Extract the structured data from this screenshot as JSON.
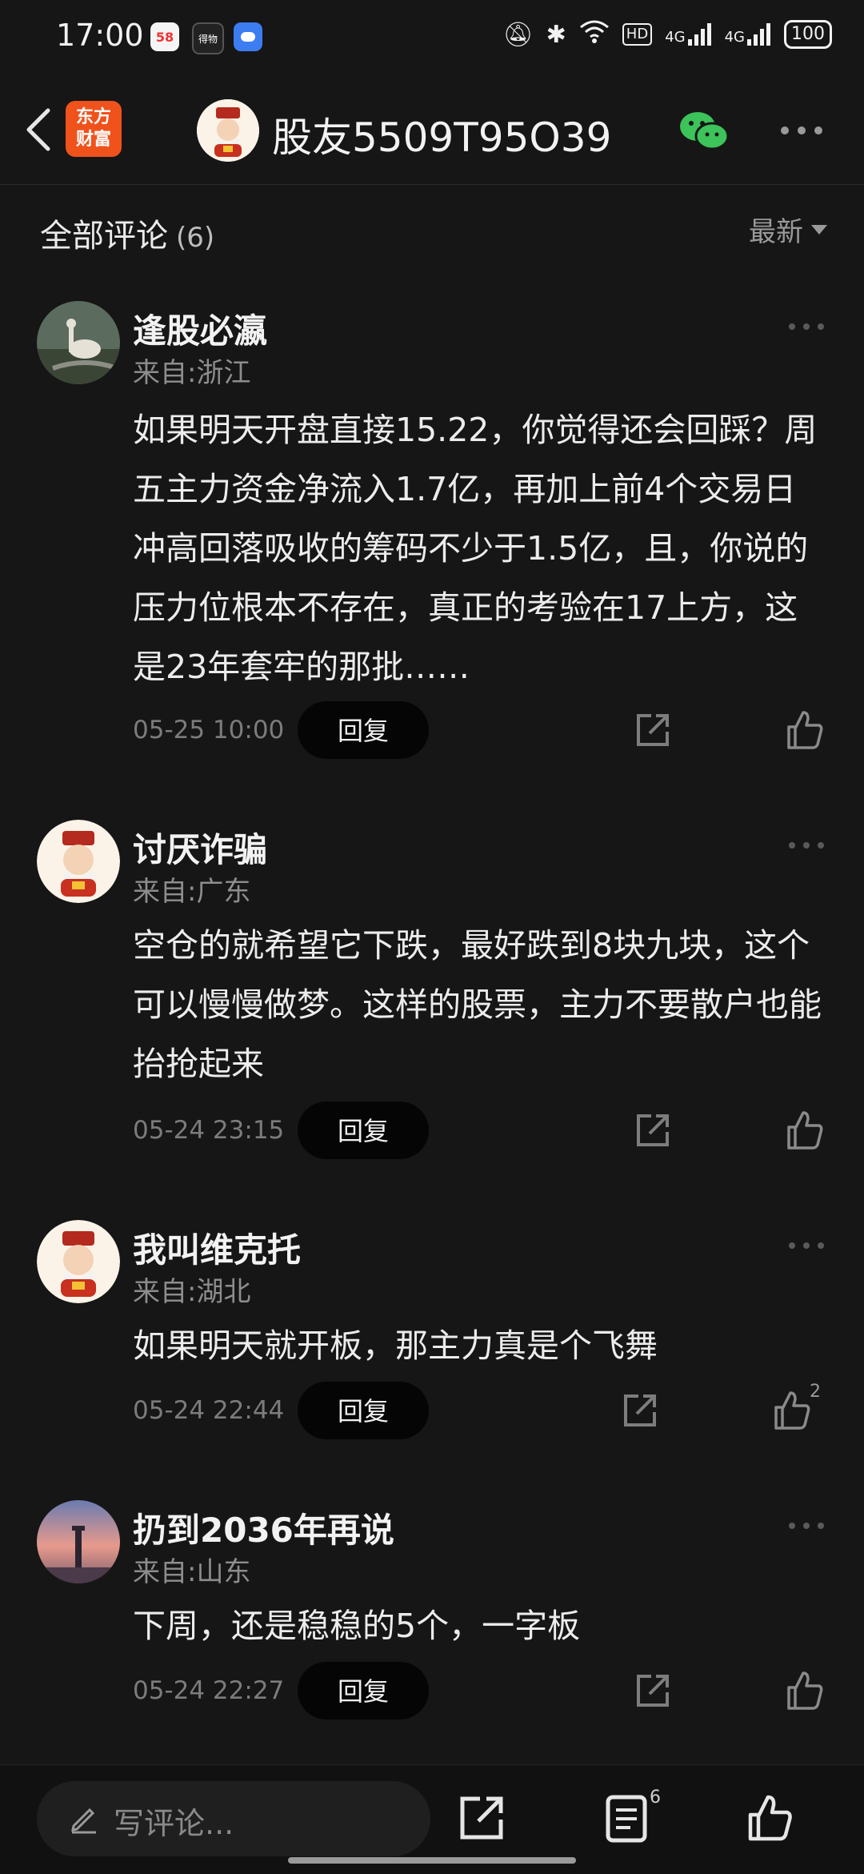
{
  "status_bar": {
    "time": "17:00",
    "apps": [
      "58",
      "得物",
      "meet"
    ],
    "network_1": "4G",
    "network_2": "4G",
    "hd": "HD",
    "battery": "100"
  },
  "header": {
    "logo_text_1": "东方",
    "logo_text_2": "财富",
    "title": "股友5509T95O39"
  },
  "section": {
    "title": "全部评论",
    "count": "(6)",
    "sort_label": "最新"
  },
  "comments": [
    {
      "user": "逢股必瀛",
      "location": "来自:浙江",
      "text": "如果明天开盘直接15.22，你觉得还会回踩？周五主力资金净流入1.7亿，再加上前4个交易日冲高回落吸收的筹码不少于1.5亿，且，你说的压力位根本不存在，真正的考验在17上方，这是23年套牢的那批……",
      "time": "05-25 10:00",
      "reply_label": "回复",
      "likes": ""
    },
    {
      "user": "讨厌诈骗",
      "location": "来自:广东",
      "text": "空仓的就希望它下跌，最好跌到8块九块，这个可以慢慢做梦。这样的股票，主力不要散户也能抬抢起来",
      "time": "05-24 23:15",
      "reply_label": "回复",
      "likes": ""
    },
    {
      "user": "我叫维克托",
      "location": "来自:湖北",
      "text": "如果明天就开板，那主力真是个飞舞",
      "time": "05-24 22:44",
      "reply_label": "回复",
      "likes": "2"
    },
    {
      "user": "扔到2036年再说",
      "location": "来自:山东",
      "text": "下周，还是稳稳的5个，一字板",
      "time": "05-24 22:27",
      "reply_label": "回复",
      "likes": ""
    }
  ],
  "bottom_bar": {
    "placeholder": "写评论...",
    "comment_badge": "6"
  },
  "colors": {
    "background": "#161616",
    "reply_button": "#050505",
    "logo": "#f0521c",
    "wechat": "#3cc35a"
  }
}
